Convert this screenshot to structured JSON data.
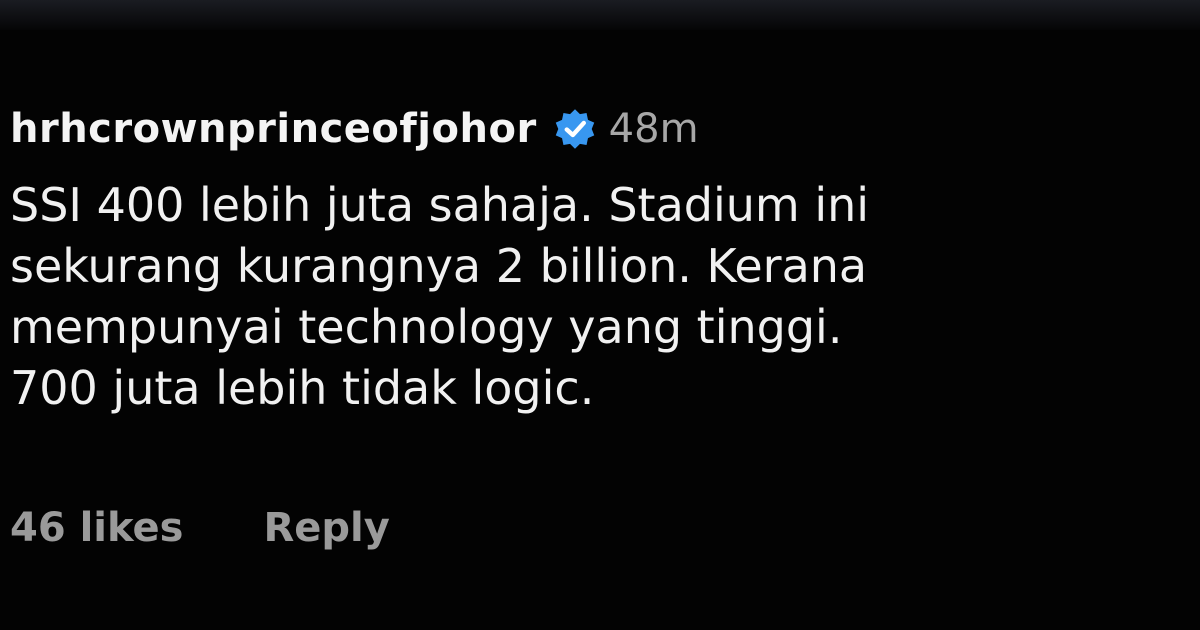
{
  "comment": {
    "username": "hrhcrownprinceofjohor",
    "verified_icon": "verified-badge-icon",
    "verified_color": "#3897f0",
    "timestamp": "48m",
    "text": "SSI 400 lebih juta sahaja. Stadium ini\nsekurang kurangnya 2 billion. Kerana\nmempunyai technology yang tinggi.\n700 juta lebih tidak logic.",
    "likes": "46 likes",
    "reply_label": "Reply"
  }
}
